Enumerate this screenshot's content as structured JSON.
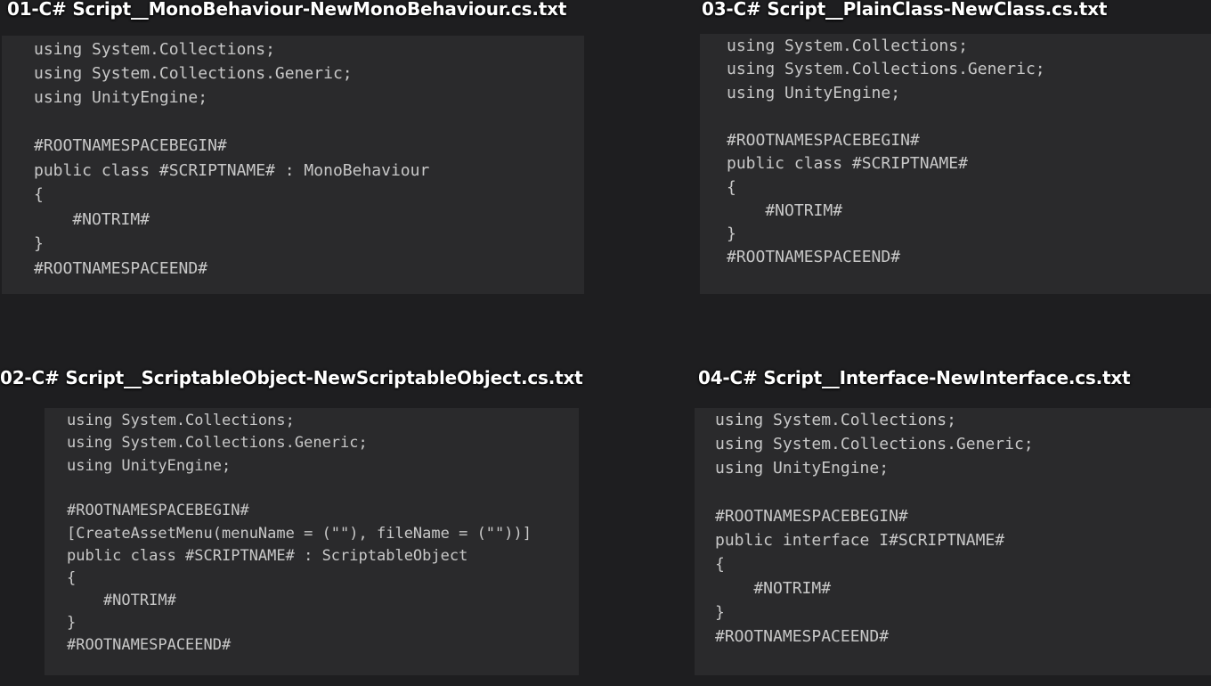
{
  "panels": [
    {
      "id": "01",
      "title": "01-C# Script__MonoBehaviour-NewMonoBehaviour.cs.txt",
      "lines": [
        "using System.Collections;",
        "using System.Collections.Generic;",
        "using UnityEngine;",
        "",
        "#ROOTNAMESPACEBEGIN#",
        "public class #SCRIPTNAME# : MonoBehaviour",
        "{",
        "    #NOTRIM#",
        "}",
        "#ROOTNAMESPACEEND#"
      ]
    },
    {
      "id": "03",
      "title": "03-C# Script__PlainClass-NewClass.cs.txt",
      "lines": [
        "using System.Collections;",
        "using System.Collections.Generic;",
        "using UnityEngine;",
        "",
        "#ROOTNAMESPACEBEGIN#",
        "public class #SCRIPTNAME#",
        "{",
        "    #NOTRIM#",
        "}",
        "#ROOTNAMESPACEEND#"
      ]
    },
    {
      "id": "02",
      "title": "02-C# Script__ScriptableObject-NewScriptableObject.cs.txt",
      "lines": [
        "using System.Collections;",
        "using System.Collections.Generic;",
        "using UnityEngine;",
        "",
        "#ROOTNAMESPACEBEGIN#",
        "[CreateAssetMenu(menuName = (\"\"), fileName = (\"\"))]",
        "public class #SCRIPTNAME# : ScriptableObject",
        "{",
        "    #NOTRIM#",
        "}",
        "#ROOTNAMESPACEEND#"
      ]
    },
    {
      "id": "04",
      "title": "04-C# Script__Interface-NewInterface.cs.txt",
      "lines": [
        "using System.Collections;",
        "using System.Collections.Generic;",
        "using UnityEngine;",
        "",
        "#ROOTNAMESPACEBEGIN#",
        "public interface I#SCRIPTNAME#",
        "{",
        "    #NOTRIM#",
        "}",
        "#ROOTNAMESPACEEND#"
      ]
    }
  ]
}
